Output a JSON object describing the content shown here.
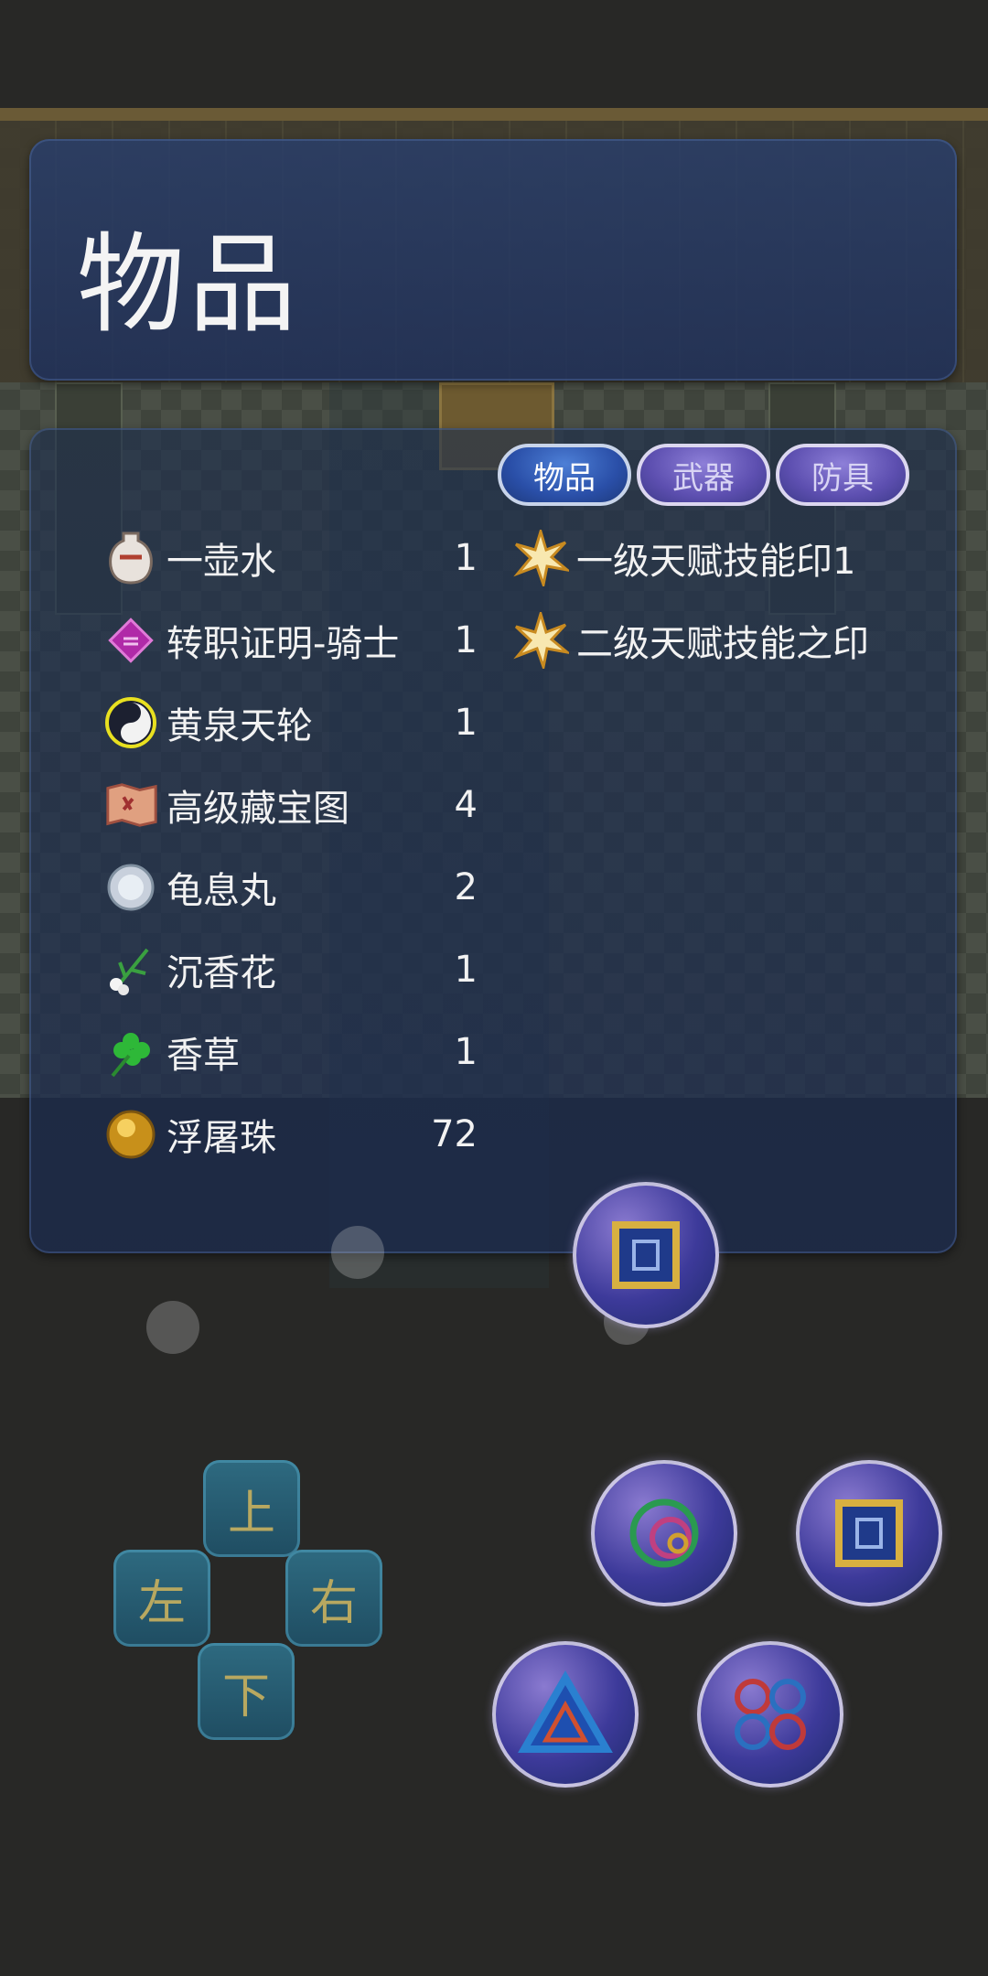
{
  "title": "物品",
  "tabs": [
    {
      "label": "物品",
      "active": true
    },
    {
      "label": "武器",
      "active": false
    },
    {
      "label": "防具",
      "active": false
    }
  ],
  "items_left": [
    {
      "name": "一壶水",
      "qty": "1",
      "icon": "water-jar-icon"
    },
    {
      "name": "转职证明-骑士",
      "qty": "1",
      "icon": "purple-scroll-icon"
    },
    {
      "name": "黄泉天轮",
      "qty": "1",
      "icon": "yin-yang-wheel-icon"
    },
    {
      "name": "高级藏宝图",
      "qty": "4",
      "icon": "treasure-map-icon"
    },
    {
      "name": "龟息丸",
      "qty": "2",
      "icon": "pill-icon"
    },
    {
      "name": "沉香花",
      "qty": "1",
      "icon": "flower-icon"
    },
    {
      "name": "香草",
      "qty": "1",
      "icon": "clover-icon"
    },
    {
      "name": "浮屠珠",
      "qty": "72",
      "icon": "gold-bead-icon"
    }
  ],
  "items_right": [
    {
      "name": "一级天赋技能印1",
      "icon": "starburst-icon"
    },
    {
      "name": "二级天赋技能之印",
      "icon": "starburst-icon"
    }
  ],
  "dpad": {
    "up": "上",
    "down": "下",
    "left": "左",
    "right": "右"
  },
  "colors": {
    "panel": "#283e6c",
    "tab_active": "#2a4fa8",
    "tab_inactive": "#5d4fb0"
  }
}
